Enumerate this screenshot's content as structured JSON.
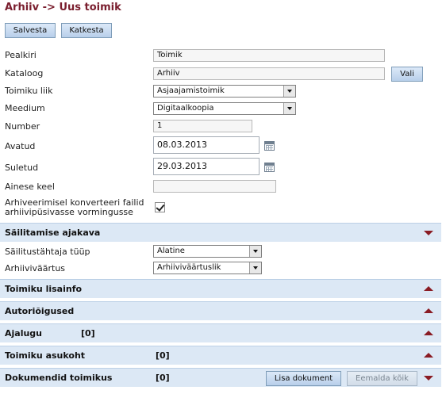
{
  "page": {
    "title": "Arhiiv -> Uus toimik"
  },
  "toolbar": {
    "save_label": "Salvesta",
    "cancel_label": "Katkesta"
  },
  "form": {
    "title": {
      "label": "Pealkiri",
      "value": "Toimik"
    },
    "catalog": {
      "label": "Kataloog",
      "value": "Arhiiv",
      "choose_label": "Vali"
    },
    "type": {
      "label": "Toimiku liik",
      "value": "Asjaajamistoimik"
    },
    "medium": {
      "label": "Meedium",
      "value": "Digitaalkoopia"
    },
    "number": {
      "label": "Number",
      "value": "1"
    },
    "opened": {
      "label": "Avatud",
      "value": "08.03.2013"
    },
    "closed": {
      "label": "Suletud",
      "value": "29.03.2013"
    },
    "language": {
      "label": "Ainese keel",
      "value": ""
    },
    "convert": {
      "label": "Arhiveerimisel konverteeri failid arhiivipüsivasse vormingusse",
      "checked": true
    }
  },
  "retention": {
    "title": "Säilitamise ajakava",
    "term_type": {
      "label": "Säilitustähtaja tüüp",
      "value": "Alatine"
    },
    "archival_value": {
      "label": "Arhiiviväärtus",
      "value": "Arhiiviväärtuslik"
    }
  },
  "sections": {
    "extra_info": {
      "title": "Toimiku lisainfo"
    },
    "copyright": {
      "title": "Autoriõigused"
    },
    "history": {
      "title": "Ajalugu",
      "count": "[0]"
    },
    "location": {
      "title": "Toimiku asukoht",
      "count": "[0]"
    },
    "documents": {
      "title": "Dokumendid toimikus",
      "count": "[0]",
      "add_label": "Lisa dokument",
      "remove_label": "Eemalda kõik"
    }
  },
  "icons": {
    "expand": "triangle-down-icon",
    "collapse": "triangle-up-icon",
    "calendar": "calendar-icon",
    "checkbox": "checkmark-icon"
  },
  "colors": {
    "title": "#7a1e2e",
    "section_bg": "#dce8f5",
    "toggle_arrow": "#8a1c24",
    "button_bg": "#c8daf0"
  }
}
